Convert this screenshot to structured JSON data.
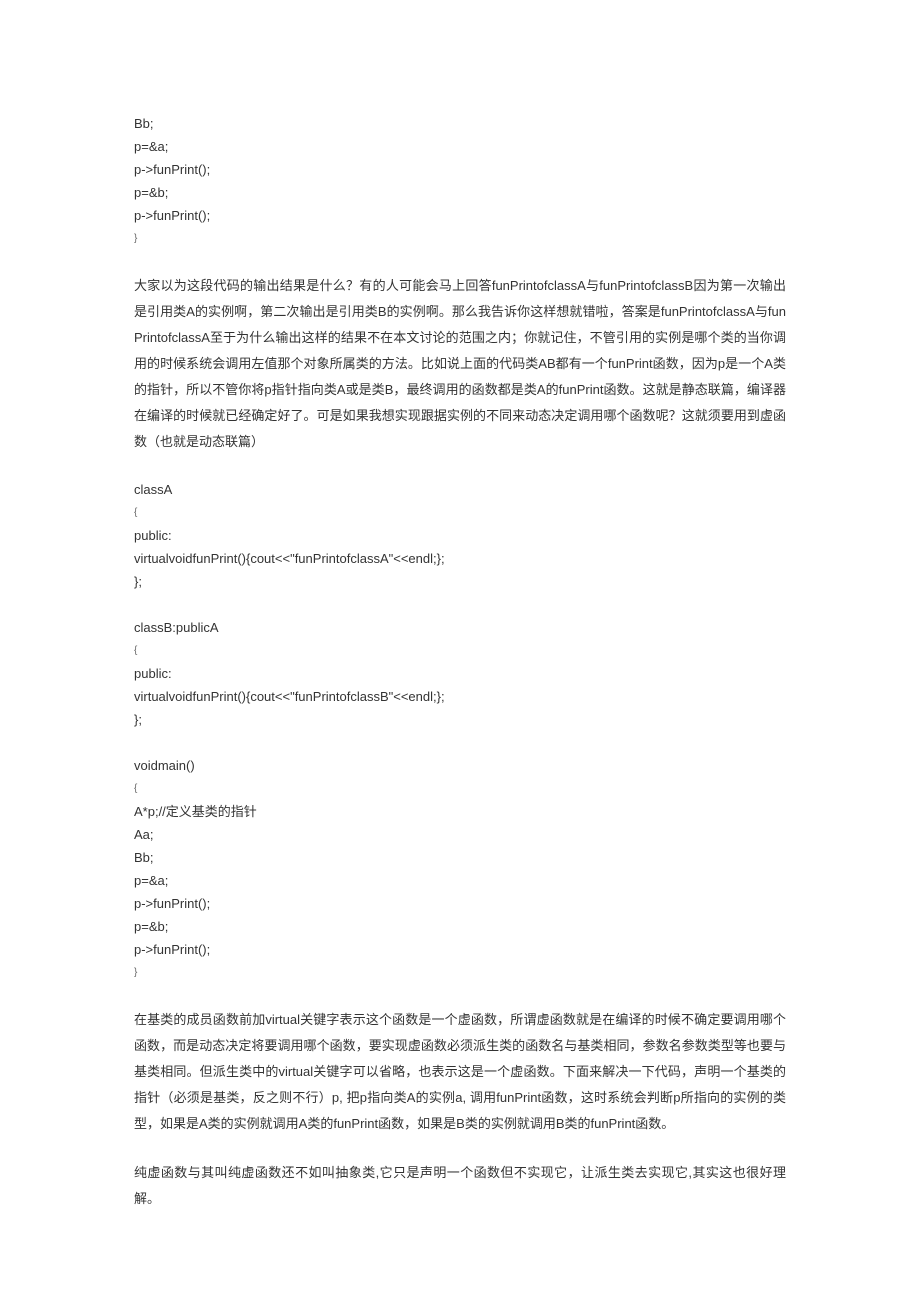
{
  "lines": [
    {
      "t": "code",
      "v": "Bb;"
    },
    {
      "t": "code",
      "v": "p=&a;"
    },
    {
      "t": "code",
      "v": "p->funPrint();"
    },
    {
      "t": "code",
      "v": "p=&b;"
    },
    {
      "t": "code",
      "v": "p->funPrint();"
    },
    {
      "t": "brace",
      "v": "}"
    },
    {
      "t": "spacer"
    },
    {
      "t": "para",
      "v": "大家以为这段代码的输出结果是什么？有的人可能会马上回答funPrintofclassA与funPrintofclassB因为第一次输出是引用类A的实例啊，第二次输出是引用类B的实例啊。那么我告诉你这样想就错啦，答案是funPrintofclassA与funPrintofclassA至于为什么输出这样的结果不在本文讨论的范围之内；你就记住，不管引用的实例是哪个类的当你调用的时候系统会调用左值那个对象所属类的方法。比如说上面的代码类AB都有一个funPrint函数，因为p是一个A类的指针，所以不管你将p指针指向类A或是类B，最终调用的函数都是类A的funPrint函数。这就是静态联篇，编译器在编译的时候就已经确定好了。可是如果我想实现跟据实例的不同来动态决定调用哪个函数呢？这就须要用到虚函数（也就是动态联篇）"
    },
    {
      "t": "spacer"
    },
    {
      "t": "code",
      "v": "classA"
    },
    {
      "t": "brace",
      "v": "{"
    },
    {
      "t": "code",
      "v": "public:"
    },
    {
      "t": "code",
      "v": "virtualvoidfunPrint(){cout<<\"funPrintofclassA\"<<endl;};"
    },
    {
      "t": "code",
      "v": "};"
    },
    {
      "t": "spacer"
    },
    {
      "t": "code",
      "v": "classB:publicA"
    },
    {
      "t": "brace",
      "v": "{"
    },
    {
      "t": "code",
      "v": "public:"
    },
    {
      "t": "code",
      "v": "virtualvoidfunPrint(){cout<<\"funPrintofclassB\"<<endl;};"
    },
    {
      "t": "code",
      "v": "};"
    },
    {
      "t": "spacer"
    },
    {
      "t": "code",
      "v": "voidmain()"
    },
    {
      "t": "brace",
      "v": "{"
    },
    {
      "t": "code",
      "v": "A*p;//定义基类的指针"
    },
    {
      "t": "code",
      "v": "Aa;"
    },
    {
      "t": "code",
      "v": "Bb;"
    },
    {
      "t": "code",
      "v": "p=&a;"
    },
    {
      "t": "code",
      "v": "p->funPrint();"
    },
    {
      "t": "code",
      "v": "p=&b;"
    },
    {
      "t": "code",
      "v": "p->funPrint();"
    },
    {
      "t": "brace",
      "v": "}"
    },
    {
      "t": "spacer"
    },
    {
      "t": "para",
      "v": "在基类的成员函数前加virtual关键字表示这个函数是一个虚函数，所谓虚函数就是在编译的时候不确定要调用哪个函数，而是动态决定将要调用哪个函数，要实现虚函数必须派生类的函数名与基类相同，参数名参数类型等也要与基类相同。但派生类中的virtual关键字可以省略，也表示这是一个虚函数。下面来解决一下代码，声明一个基类的指针（必须是基类，反之则不行）p, 把p指向类A的实例a, 调用funPrint函数，这时系统会判断p所指向的实例的类型，如果是A类的实例就调用A类的funPrint函数，如果是B类的实例就调用B类的funPrint函数。"
    },
    {
      "t": "spacer"
    },
    {
      "t": "para",
      "v": "纯虚函数与其叫纯虚函数还不如叫抽象类,它只是声明一个函数但不实现它，让派生类去实现它,其实这也很好理解。"
    }
  ]
}
